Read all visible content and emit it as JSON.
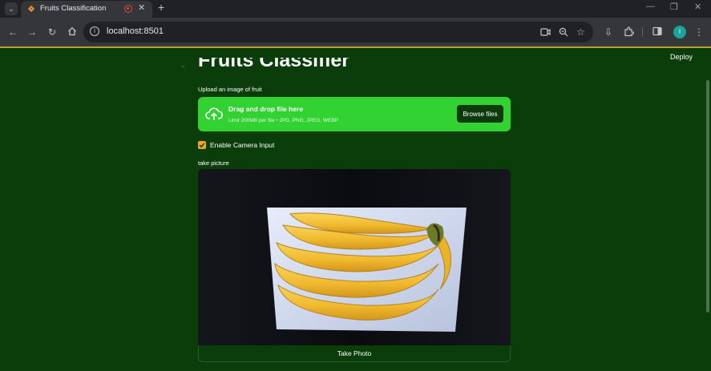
{
  "browser": {
    "tab_title": "Fruits Classification",
    "tab_close": "✕",
    "new_tab": "+",
    "url": "localhost:8501",
    "profile_initial": "I",
    "icons": [
      "tab-list-icon",
      "back-icon",
      "forward-icon",
      "reload-icon",
      "home-icon",
      "site-info-icon",
      "camera-icon",
      "zoom-icon",
      "bookmark-star-icon",
      "download-icon",
      "extensions-icon",
      "side-panel-icon",
      "menu-icon",
      "minimize-icon",
      "maximize-icon",
      "close-icon"
    ]
  },
  "app": {
    "deploy_label": "Deploy",
    "title": "Fruits Classifier",
    "uploader": {
      "label": "Upload an image of fruit",
      "drop_title": "Drag and drop file here",
      "drop_limit": "Limit 200MB per file • JPG, PNG, JPEG, WEBP",
      "browse_label": "Browse files"
    },
    "camera_toggle": {
      "label": "Enable Camera Input",
      "checked": true
    },
    "camera": {
      "label": "take picture",
      "take_photo_label": "Take Photo"
    },
    "colors": {
      "background": "#0b3d0b",
      "dropzone": "#33d233",
      "checkbox": "#f0a818"
    }
  }
}
